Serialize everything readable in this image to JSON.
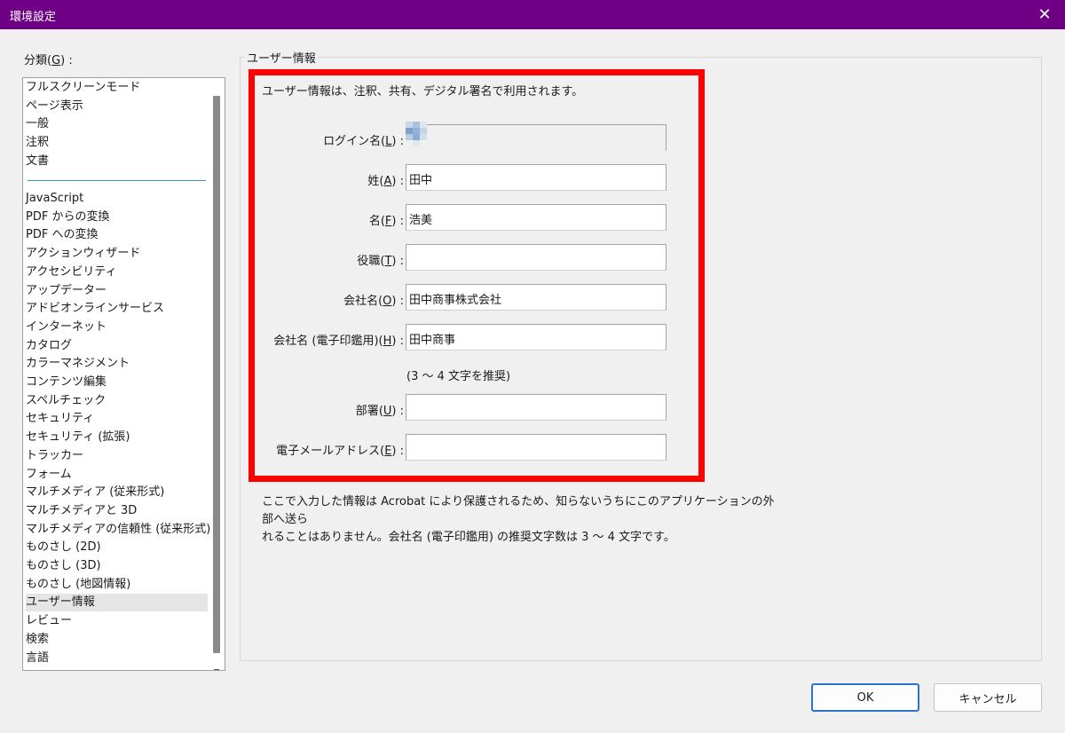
{
  "window": {
    "title": "環境設定"
  },
  "category": {
    "label": "分類",
    "accel": "G",
    "items_top": [
      "フルスクリーンモード",
      "ページ表示",
      "一般",
      "注釈",
      "文書"
    ],
    "items": [
      "JavaScript",
      "PDF からの変換",
      "PDF への変換",
      "アクションウィザード",
      "アクセシビリティ",
      "アップデーター",
      "アドビオンラインサービス",
      "インターネット",
      "カタログ",
      "カラーマネジメント",
      "コンテンツ編集",
      "スペルチェック",
      "セキュリティ",
      "セキュリティ (拡張)",
      "トラッカー",
      "フォーム",
      "マルチメディア (従来形式)",
      "マルチメディアと 3D",
      "マルチメディアの信頼性 (従来形式)",
      "ものさし (2D)",
      "ものさし (3D)",
      "ものさし (地図情報)",
      "ユーザー情報",
      "レビュー",
      "検索",
      "言語"
    ],
    "selected": "ユーザー情報"
  },
  "panel": {
    "title": "ユーザー情報",
    "intro": "ユーザー情報は、注釈、共有、デジタル署名で利用されます。",
    "fields": [
      {
        "label": "ログイン名",
        "accel": "L",
        "value": ""
      },
      {
        "label": "姓",
        "accel": "A",
        "value": "田中"
      },
      {
        "label": "名",
        "accel": "F",
        "value": "浩美"
      },
      {
        "label": "役職",
        "accel": "T",
        "value": ""
      },
      {
        "label": "会社名",
        "accel": "O",
        "value": "田中商事株式会社"
      },
      {
        "label": "会社名 (電子印鑑用)",
        "accel": "H",
        "value": "田中商事"
      },
      {
        "label": "部署",
        "accel": "U",
        "value": ""
      },
      {
        "label": "電子メールアドレス",
        "accel": "E",
        "value": ""
      }
    ],
    "hint": "(3 ～ 4 文字を推奨)",
    "note_line1": "ここで入力した情報は Acrobat により保護されるため、知らないうちにこのアプリケーションの外部へ送ら",
    "note_line2": "れることはありません。会社名 (電子印鑑用) の推奨文字数は 3 ～ 4 文字です。"
  },
  "buttons": {
    "ok": "OK",
    "cancel": "キャンセル"
  },
  "colors": {
    "titlebar": "#6f0085",
    "highlight_box": "#ff0000",
    "separator": "#3a93c9"
  }
}
